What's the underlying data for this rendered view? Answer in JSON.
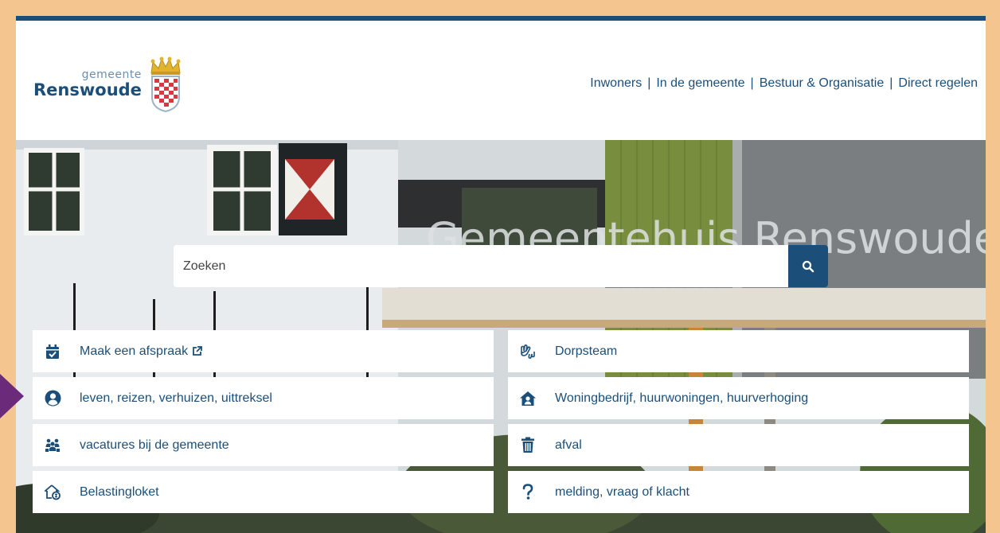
{
  "header": {
    "logo_small": "gemeente",
    "logo_big": "Renswoude",
    "nav": [
      "Inwoners",
      "In de gemeente",
      "Bestuur & Organisatie",
      "Direct regelen"
    ]
  },
  "hero": {
    "building_sign": "Gemeentehuis Renswoude"
  },
  "search": {
    "placeholder": "Zoeken"
  },
  "tiles": [
    {
      "label": "Maak een afspraak",
      "icon": "calendar-check-icon",
      "external": true
    },
    {
      "label": "Dorpsteam",
      "icon": "hands-icon"
    },
    {
      "label": "leven, reizen, verhuizen, uittreksel",
      "icon": "user-circle-icon"
    },
    {
      "label": "Woningbedrijf, huurwoningen, huurverhoging",
      "icon": "house-user-icon"
    },
    {
      "label": "vacatures bij de gemeente",
      "icon": "people-group-icon"
    },
    {
      "label": "afval",
      "icon": "trash-icon"
    },
    {
      "label": "Belastingloket",
      "icon": "house-coin-icon"
    },
    {
      "label": "melding, vraag of klacht",
      "icon": "question-icon"
    }
  ],
  "colors": {
    "brand": "#1b4f7a",
    "page_border": "#f5c58f",
    "side_marker": "#6b2a7a"
  }
}
